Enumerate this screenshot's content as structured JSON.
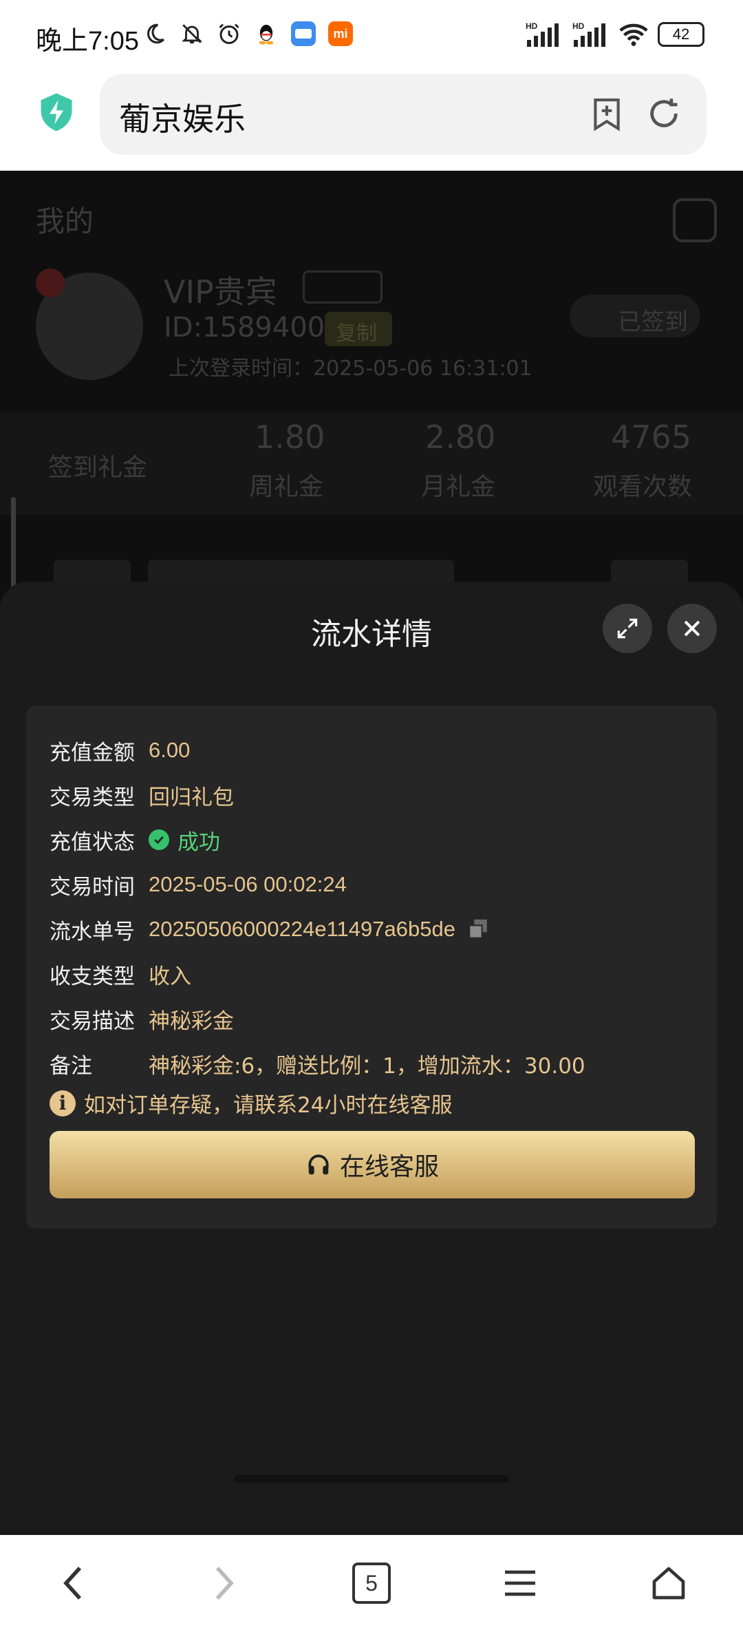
{
  "status_bar": {
    "time": "晚上7:05",
    "battery": "42",
    "icons": [
      "moon-icon",
      "bell-off-icon",
      "alarm-icon",
      "qq-app-icon",
      "mail-app-icon",
      "mi-app-icon",
      "hd-signal-icon",
      "hd-signal-icon",
      "wifi-icon",
      "battery-icon"
    ],
    "mi_app_label": "mi"
  },
  "browser": {
    "url_text": "葡京娱乐",
    "tab_count": "5"
  },
  "background_page": {
    "title": "我的",
    "user_name": "VIP贵宾",
    "user_id": "ID:1589400",
    "copy_label": "复制",
    "last_login": "上次登录时间：2025-05-06 16:31:01",
    "signed_label": "已签到",
    "stats": [
      {
        "label": "签到礼金",
        "value": ""
      },
      {
        "label": "周礼金",
        "value": "1.80"
      },
      {
        "label": "月礼金",
        "value": "2.80"
      },
      {
        "label": "观看次数",
        "value": "4765"
      }
    ]
  },
  "sheet": {
    "title": "流水详情",
    "rows": [
      {
        "key": "充值金额",
        "value": "6.00"
      },
      {
        "key": "交易类型",
        "value": "回归礼包"
      },
      {
        "key": "充值状态",
        "value": "成功"
      },
      {
        "key": "交易时间",
        "value": "2025-05-06 00:02:24"
      },
      {
        "key": "流水单号",
        "value": "20250506000224e11497a6b5de"
      },
      {
        "key": "收支类型",
        "value": "收入"
      },
      {
        "key": "交易描述",
        "value": "神秘彩金"
      },
      {
        "key": "备注",
        "value": "神秘彩金:6，赠送比例：1，增加流水：30.00"
      }
    ],
    "notice": "如对订单存疑，请联系24小时在线客服",
    "cs_button_label": "在线客服"
  },
  "colors": {
    "accent_gold": "#e6c58e",
    "success_green": "#56d37a",
    "sheet_bg": "#1b1b1b",
    "card_bg": "#262626"
  }
}
